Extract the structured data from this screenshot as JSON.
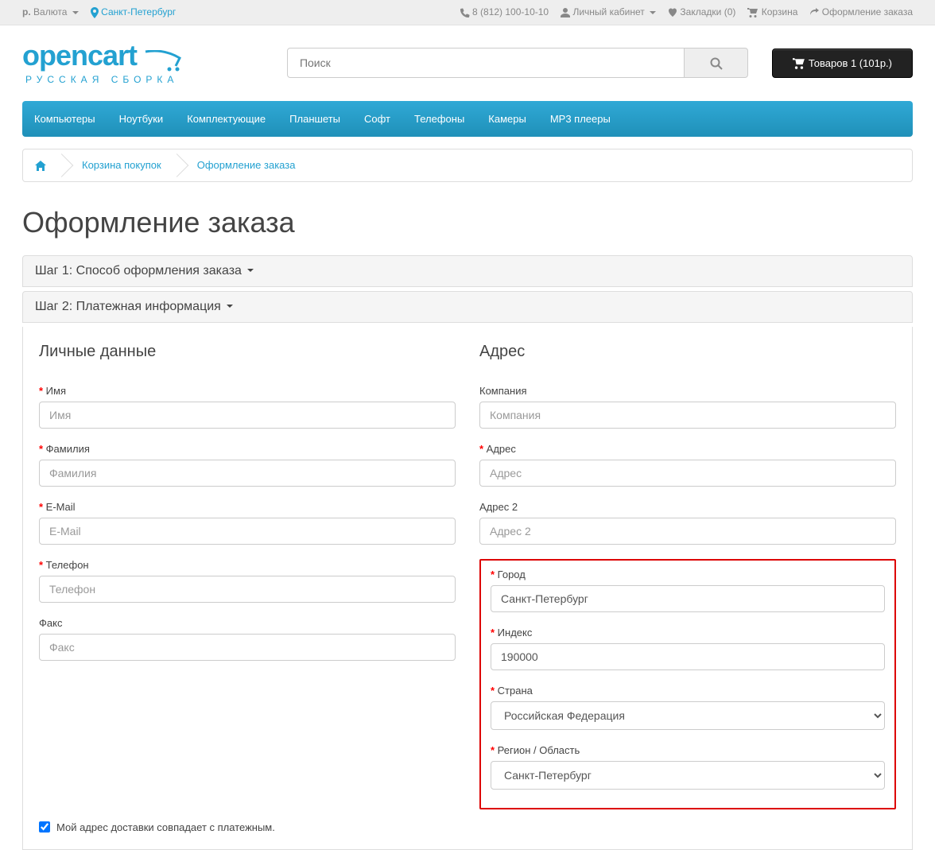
{
  "top": {
    "currency_label": "р.",
    "currency_word": "Валюта",
    "city": "Санкт-Петербург",
    "phone": "8 (812) 100-10-10",
    "account": "Личный кабинет",
    "wishlist": "Закладки (0)",
    "cart": "Корзина",
    "checkout": "Оформление заказа"
  },
  "logo": {
    "main": "opencart",
    "sub": "Русская сборка"
  },
  "search": {
    "placeholder": "Поиск"
  },
  "cart_btn": "Товаров 1 (101р.)",
  "nav": [
    "Компьютеры",
    "Ноутбуки",
    "Комплектующие",
    "Планшеты",
    "Софт",
    "Телефоны",
    "Камеры",
    "MP3 плееры"
  ],
  "breadcrumb": {
    "cart": "Корзина покупок",
    "checkout": "Оформление заказа"
  },
  "page_title": "Оформление заказа",
  "step1": "Шаг 1: Способ оформления заказа",
  "step2": "Шаг 2: Платежная информация",
  "personal": {
    "heading": "Личные данные",
    "firstname_label": "Имя",
    "firstname_ph": "Имя",
    "lastname_label": "Фамилия",
    "lastname_ph": "Фамилия",
    "email_label": "E-Mail",
    "email_ph": "E-Mail",
    "phone_label": "Телефон",
    "phone_ph": "Телефон",
    "fax_label": "Факс",
    "fax_ph": "Факс"
  },
  "address": {
    "heading": "Адрес",
    "company_label": "Компания",
    "company_ph": "Компания",
    "addr1_label": "Адрес",
    "addr1_ph": "Адрес",
    "addr2_label": "Адрес 2",
    "addr2_ph": "Адрес 2",
    "city_label": "Город",
    "city_val": "Санкт-Петербург",
    "postcode_label": "Индекс",
    "postcode_val": "190000",
    "country_label": "Страна",
    "country_val": "Российская Федерация",
    "region_label": "Регион / Область",
    "region_val": "Санкт-Петербург"
  },
  "same_address": "Мой адрес доставки совпадает с платежным."
}
